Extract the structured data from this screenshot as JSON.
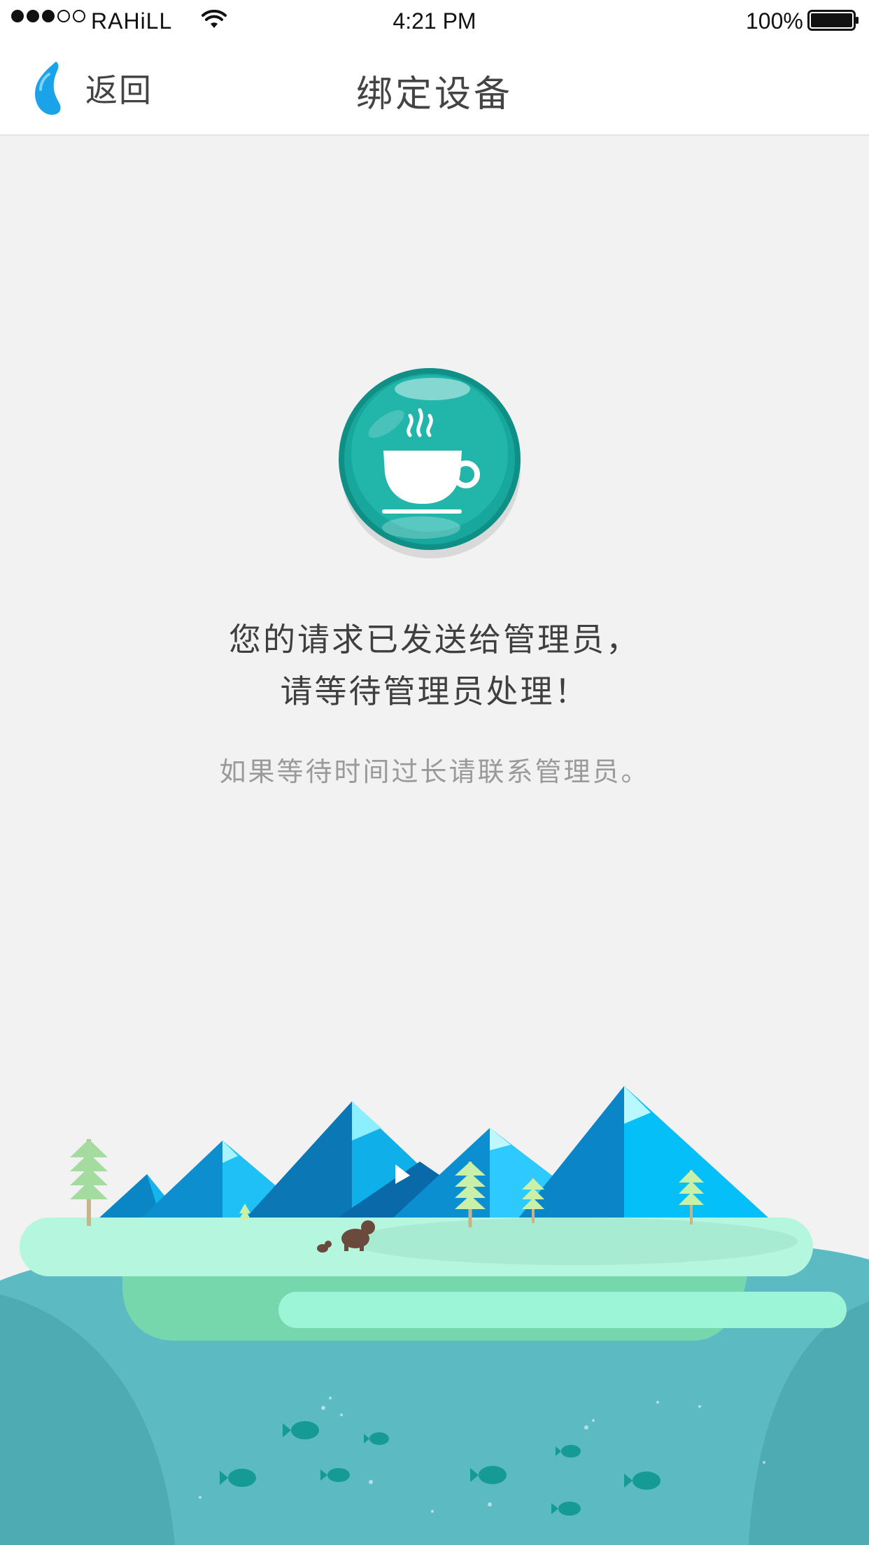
{
  "status_bar": {
    "carrier": "RAHiLL",
    "time": "4:21 PM",
    "battery_percent": "100%",
    "signal_bars_filled": 3,
    "signal_bars_total": 5,
    "wifi_icon": "wifi-icon",
    "battery_icon": "battery-icon"
  },
  "nav": {
    "back_label": "返回",
    "back_icon": "back-drop-icon",
    "title": "绑定设备"
  },
  "main": {
    "badge_icon": "coffee-cup-icon",
    "message_line1": "您的请求已发送给管理员，",
    "message_line2": "请等待管理员处理！",
    "hint": "如果等待时间过长请联系管理员。"
  },
  "illustration": {
    "name": "mountain-lake-illustration"
  },
  "colors": {
    "accent_teal": "#129e94",
    "back_icon_blue": "#1aa3e8",
    "title_text": "#444444",
    "hint_text": "#9a9a9a",
    "background": "#f2f2f2"
  }
}
